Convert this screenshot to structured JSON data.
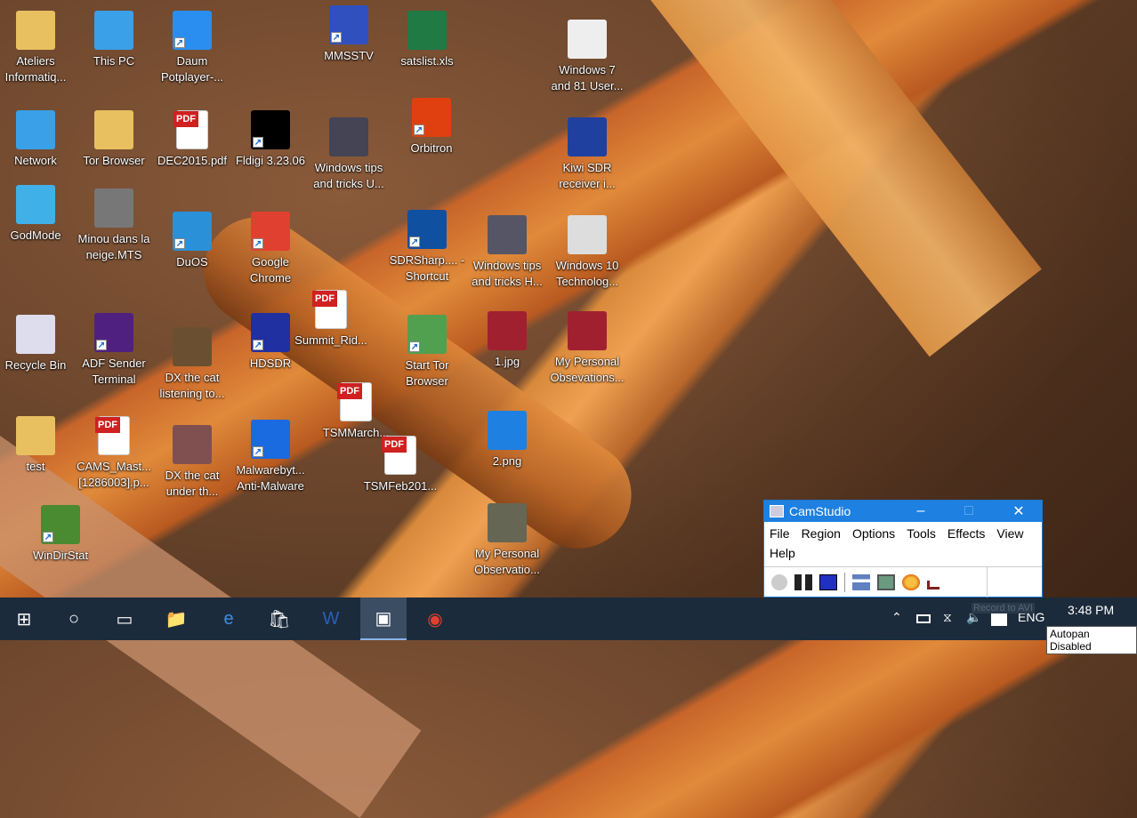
{
  "desktop_icons": [
    {
      "label": "Ateliers Informatiq...",
      "icon": "user-folder-icon",
      "color": "#e8c060"
    },
    {
      "label": "This PC",
      "icon": "computer-icon",
      "color": "#3aa0e8"
    },
    {
      "label": "Daum Potplayer-...",
      "icon": "play-icon",
      "color": "#2a8ef0",
      "shortcut": true
    },
    {
      "label": "MMSSTV",
      "icon": "mmsstv-icon",
      "color": "#3050c0",
      "shortcut": true
    },
    {
      "label": "satslist.xls",
      "icon": "excel-icon",
      "color": "#1f7a44"
    },
    {
      "label": "Windows 7 and 81 User...",
      "icon": "video-thumbnail-icon",
      "color": "#eee"
    },
    {
      "label": "Network",
      "icon": "network-icon",
      "color": "#3aa0e8"
    },
    {
      "label": "Tor Browser",
      "icon": "folder-icon",
      "color": "#e8c060"
    },
    {
      "label": "DEC2015.pdf",
      "icon": "pdf-icon",
      "color": "#fff"
    },
    {
      "label": "Fldigi 3.23.06",
      "icon": "fldigi-icon",
      "color": "#000",
      "shortcut": true
    },
    {
      "label": "Windows tips and tricks U...",
      "icon": "video-thumbnail-icon",
      "color": "#445"
    },
    {
      "label": "Orbitron",
      "icon": "orbitron-icon",
      "color": "#e04010",
      "shortcut": true
    },
    {
      "label": "Kiwi SDR receiver i...",
      "icon": "video-thumbnail-icon",
      "color": "#2040a0"
    },
    {
      "label": "GodMode",
      "icon": "control-panel-icon",
      "color": "#40b0e8"
    },
    {
      "label": "Minou dans la neige.MTS",
      "icon": "video-thumbnail-icon",
      "color": "#777"
    },
    {
      "label": "DuOS",
      "icon": "duos-icon",
      "color": "#2a90d8",
      "shortcut": true
    },
    {
      "label": "Google Chrome",
      "icon": "chrome-icon",
      "color": "#e04030",
      "shortcut": true
    },
    {
      "label": "SDRSharp.... - Shortcut",
      "icon": "sdrsharp-icon",
      "color": "#1050a0",
      "shortcut": true
    },
    {
      "label": "Windows tips and tricks H...",
      "icon": "video-thumbnail-icon",
      "color": "#556"
    },
    {
      "label": "Windows 10 Technolog...",
      "icon": "video-thumbnail-icon",
      "color": "#ddd"
    },
    {
      "label": "Summit_Rid...",
      "icon": "pdf-icon",
      "color": "#fff"
    },
    {
      "label": "Recycle Bin",
      "icon": "recycle-bin-icon",
      "color": "#dde"
    },
    {
      "label": "ADF Sender Terminal",
      "icon": "adf-icon",
      "color": "#502080",
      "shortcut": true
    },
    {
      "label": "DX the cat listening to...",
      "icon": "video-thumbnail-icon",
      "color": "#6a5030"
    },
    {
      "label": "HDSDR",
      "icon": "hdsdr-icon",
      "color": "#2030a0",
      "shortcut": true
    },
    {
      "label": "Start Tor Browser",
      "icon": "tor-globe-icon",
      "color": "#50a050",
      "shortcut": true
    },
    {
      "label": "1.jpg",
      "icon": "image-thumbnail-icon",
      "color": "#a02030"
    },
    {
      "label": "My Personal Obsevations...",
      "icon": "video-thumbnail-icon",
      "color": "#a02030"
    },
    {
      "label": "TSMMarch...",
      "icon": "pdf-icon",
      "color": "#fff"
    },
    {
      "label": "TSMFeb201...",
      "icon": "pdf-icon",
      "color": "#fff"
    },
    {
      "label": "2.png",
      "icon": "image-thumbnail-icon",
      "color": "#1e80e0"
    },
    {
      "label": "test",
      "icon": "folder-icon",
      "color": "#e8c060"
    },
    {
      "label": "CAMS_Mast... [1286003].p...",
      "icon": "pdf-icon",
      "color": "#fff"
    },
    {
      "label": "DX the cat under th...",
      "icon": "video-thumbnail-icon",
      "color": "#805050"
    },
    {
      "label": "Malwarebyt... Anti-Malware",
      "icon": "malwarebytes-icon",
      "color": "#1a6ae0",
      "shortcut": true
    },
    {
      "label": "WinDirStat",
      "icon": "tree-icon",
      "color": "#4a8a30",
      "shortcut": true
    },
    {
      "label": "My Personal Observatio...",
      "icon": "video-thumbnail-icon",
      "color": "#665"
    }
  ],
  "pdf_badge": "PDF",
  "camstudio": {
    "title": "CamStudio",
    "menu": [
      "File",
      "Region",
      "Options",
      "Tools",
      "Effects",
      "View",
      "Help"
    ],
    "toolbar": [
      "record-icon",
      "pause-icon",
      "stop-icon",
      "options-icon",
      "region-icon",
      "effects-icon",
      "autopan-icon"
    ]
  },
  "taskbar": {
    "apps": [
      "windows-start-icon",
      "cortana-search-icon",
      "task-view-icon",
      "file-explorer-icon",
      "edge-icon",
      "store-icon",
      "word-icon",
      "camstudio-icon",
      "chrome-icon"
    ],
    "tray": {
      "language": "ENG",
      "time": "3:48 PM"
    },
    "tooltip_record": "Record to AVI",
    "tooltip_autopan": "Autopan Disabled"
  }
}
